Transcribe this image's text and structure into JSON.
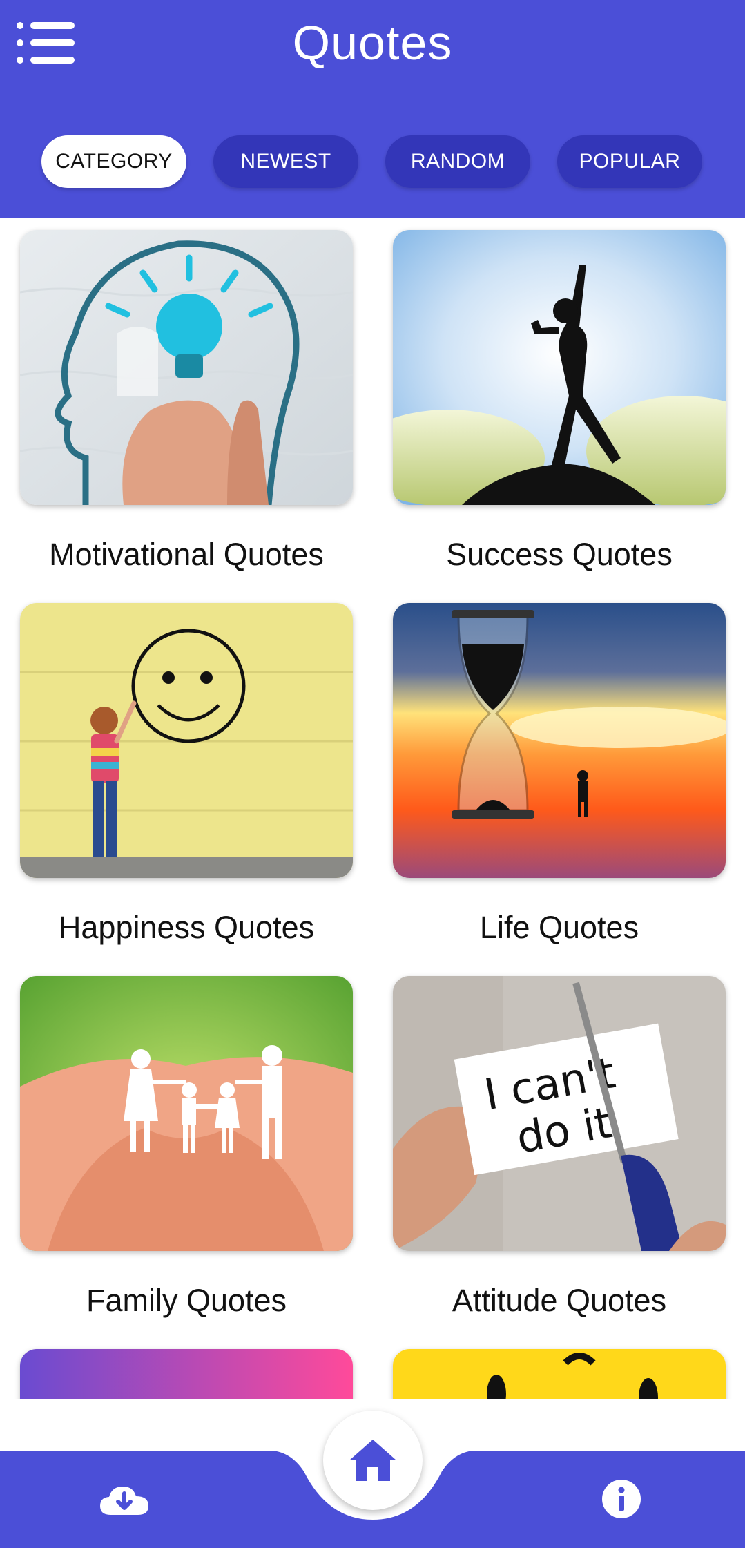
{
  "header": {
    "title": "Quotes",
    "menu_icon": "menu-icon"
  },
  "tabs": [
    {
      "label": "CATEGORY",
      "active": true
    },
    {
      "label": "NEWEST",
      "active": false
    },
    {
      "label": "RANDOM",
      "active": false
    },
    {
      "label": "POPULAR",
      "active": false
    }
  ],
  "categories": [
    {
      "label": "Motivational Quotes"
    },
    {
      "label": "Success Quotes"
    },
    {
      "label": "Happiness Quotes"
    },
    {
      "label": "Life Quotes"
    },
    {
      "label": "Family Quotes"
    },
    {
      "label": "Attitude Quotes"
    }
  ],
  "thumb_text": {
    "attitude_line1": "I can't",
    "attitude_line2": "do it"
  },
  "bottom_nav": {
    "left_icon": "cloud-download-icon",
    "center_icon": "home-icon",
    "right_icon": "info-icon"
  },
  "colors": {
    "primary": "#4b4fd7",
    "tab_inactive": "#3336b8",
    "tab_active": "#ffffff"
  }
}
